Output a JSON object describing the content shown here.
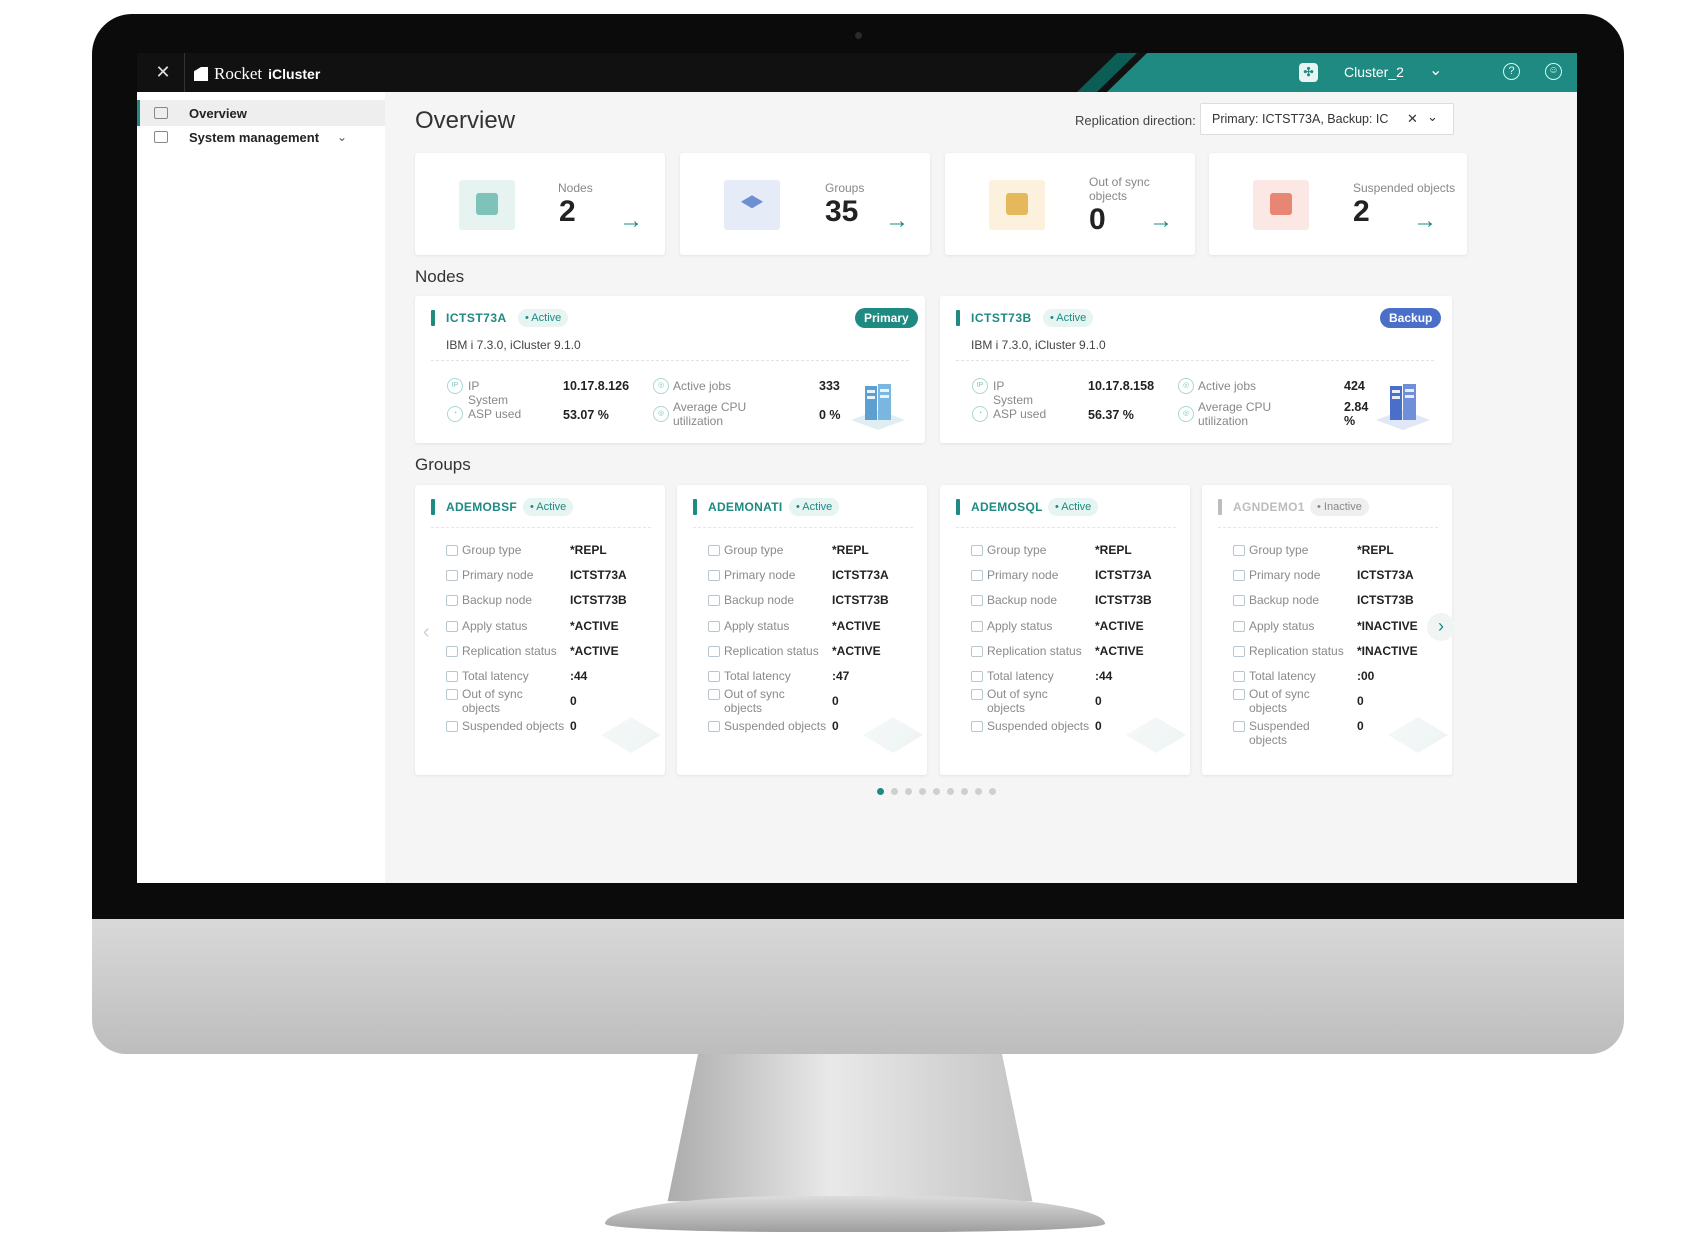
{
  "topbar": {
    "close_icon": "close-icon",
    "brand_name": "Rocket",
    "product_name": "iCluster",
    "cluster_name": "Cluster_2",
    "accent_color": "#1e8a82"
  },
  "sidebar": {
    "items": [
      {
        "label": "Overview",
        "icon": "dashboard-icon",
        "active": true
      },
      {
        "label": "System management",
        "icon": "monitor-icon",
        "expandable": true
      }
    ]
  },
  "main": {
    "title": "Overview",
    "replication_label": "Replication direction:",
    "replication_value": "Primary: ICTST73A, Backup: IC"
  },
  "stats": [
    {
      "label": "Nodes",
      "value": "2",
      "icon": "node-icon",
      "icon_color": "#e6f3f1"
    },
    {
      "label": "Groups",
      "value": "35",
      "icon": "layers-icon",
      "icon_color": "#e5ecf8"
    },
    {
      "label": "Out of sync objects",
      "value": "0",
      "icon": "sync-icon",
      "icon_color": "#fbf1dd"
    },
    {
      "label": "Suspended objects",
      "value": "2",
      "icon": "suspended-icon",
      "icon_color": "#fbe7e3"
    }
  ],
  "sections": {
    "nodes": "Nodes",
    "groups": "Groups"
  },
  "nodes": [
    {
      "name": "ICTST73A",
      "status": "• Active",
      "role": "Primary",
      "role_color": "#1e8a82",
      "version": "IBM i 7.3.0, iCluster 9.1.0",
      "ip_label": "IP",
      "ip": "10.17.8.126",
      "asp_label": "System ASP used",
      "asp": "53.07 %",
      "jobs_label": "Active jobs",
      "jobs": "333",
      "cpu_label": "Average CPU utilization",
      "cpu": "0 %"
    },
    {
      "name": "ICTST73B",
      "status": "• Active",
      "role": "Backup",
      "role_color": "#4a6fc9",
      "version": "IBM i 7.3.0, iCluster 9.1.0",
      "ip_label": "IP",
      "ip": "10.17.8.158",
      "asp_label": "System ASP used",
      "asp": "56.37 %",
      "jobs_label": "Active jobs",
      "jobs": "424",
      "cpu_label": "Average CPU utilization",
      "cpu": "2.84 %"
    }
  ],
  "group_labels": {
    "type": "Group type",
    "primary": "Primary node",
    "backup": "Backup node",
    "apply": "Apply status",
    "replication": "Replication status",
    "latency": "Total latency",
    "oos": "Out of sync objects",
    "suspended": "Suspended objects"
  },
  "groups": [
    {
      "name": "ADEMOBSF",
      "status": "• Active",
      "active": true,
      "type": "*REPL",
      "primary": "ICTST73A",
      "backup": "ICTST73B",
      "apply": "*ACTIVE",
      "replication": "*ACTIVE",
      "latency": ":44",
      "oos": "0",
      "suspended": "0"
    },
    {
      "name": "ADEMONATI",
      "status": "• Active",
      "active": true,
      "type": "*REPL",
      "primary": "ICTST73A",
      "backup": "ICTST73B",
      "apply": "*ACTIVE",
      "replication": "*ACTIVE",
      "latency": ":47",
      "oos": "0",
      "suspended": "0"
    },
    {
      "name": "ADEMOSQL",
      "status": "• Active",
      "active": true,
      "type": "*REPL",
      "primary": "ICTST73A",
      "backup": "ICTST73B",
      "apply": "*ACTIVE",
      "replication": "*ACTIVE",
      "latency": ":44",
      "oos": "0",
      "suspended": "0"
    },
    {
      "name": "AGNDEMO1",
      "status": "• Inactive",
      "active": false,
      "type": "*REPL",
      "primary": "ICTST73A",
      "backup": "ICTST73B",
      "apply": "*INACTIVE",
      "replication": "*INACTIVE",
      "latency": ":00",
      "oos": "0",
      "suspended": "0"
    }
  ],
  "carousel": {
    "pages": 9,
    "current": 1
  }
}
